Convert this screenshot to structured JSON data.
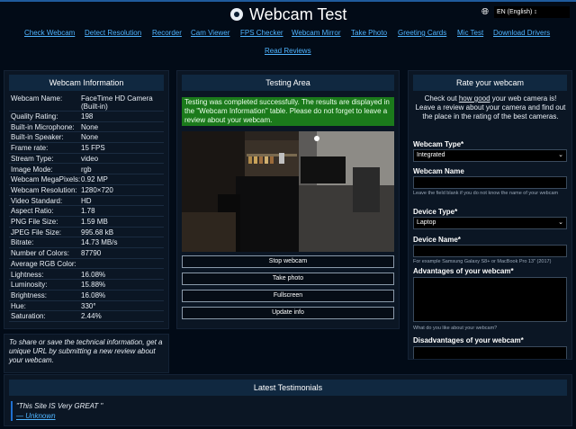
{
  "header": {
    "title": "Webcam Test",
    "language": "EN (English) ↕"
  },
  "nav": [
    "Check Webcam",
    "Detect Resolution",
    "Recorder",
    "Cam Viewer",
    "FPS Checker",
    "Webcam Mirror",
    "Take Photo",
    "Greeting Cards",
    "Mic Test",
    "Download Drivers",
    "Read Reviews"
  ],
  "info": {
    "title": "Webcam Information",
    "rows": [
      {
        "k": "Webcam Name:",
        "v": "FaceTime HD Camera (Built-in)"
      },
      {
        "k": "Quality Rating:",
        "v": "198"
      },
      {
        "k": "Built-in Microphone:",
        "v": "None"
      },
      {
        "k": "Built-in Speaker:",
        "v": "None"
      },
      {
        "k": "Frame rate:",
        "v": "15 FPS"
      },
      {
        "k": "Stream Type:",
        "v": "video"
      },
      {
        "k": "Image Mode:",
        "v": "rgb"
      },
      {
        "k": "Webcam MegaPixels:",
        "v": "0.92 MP"
      },
      {
        "k": "Webcam Resolution:",
        "v": "1280×720"
      },
      {
        "k": "Video Standard:",
        "v": "HD"
      },
      {
        "k": "Aspect Ratio:",
        "v": "1.78"
      },
      {
        "k": "PNG File Size:",
        "v": "1.59 MB"
      },
      {
        "k": "JPEG File Size:",
        "v": "995.68 kB"
      },
      {
        "k": "Bitrate:",
        "v": "14.73 MB/s"
      },
      {
        "k": "Number of Colors:",
        "v": "87790"
      },
      {
        "k": "Average RGB Color:",
        "v": ""
      },
      {
        "k": "Lightness:",
        "v": "16.08%"
      },
      {
        "k": "Luminosity:",
        "v": "15.88%"
      },
      {
        "k": "Brightness:",
        "v": "16.08%"
      },
      {
        "k": "Hue:",
        "v": "330°"
      },
      {
        "k": "Saturation:",
        "v": "2.44%"
      }
    ],
    "share_note": "To share or save the technical information, get a unique URL by submitting a new review about your webcam."
  },
  "testing": {
    "title": "Testing Area",
    "notice": "Testing was completed successfully. The results are displayed in the \"Webcam Information\" table. Please do not forget to leave a review about your webcam.",
    "buttons": [
      "Stop webcam",
      "Take photo",
      "Fullscreen",
      "Update info"
    ]
  },
  "rate": {
    "title": "Rate your webcam",
    "intro_before": "Check out ",
    "intro_link": "how good",
    "intro_after": " your web camera is! Leave a review about your camera and find out the place in the rating of the best cameras.",
    "webcam_type_label": "Webcam Type*",
    "webcam_type_value": "Integrated",
    "webcam_name_label": "Webcam Name",
    "webcam_name_hint": "Leave the field blank if you do not know the name of your webcam",
    "device_type_label": "Device Type*",
    "device_type_value": "Laptop",
    "device_name_label": "Device Name*",
    "device_name_hint": "For example Samsung Galaxy S8+ or MacBook Pro 13\" (2017)",
    "advantages_label": "Advantages of your webcam*",
    "advantages_hint": "What do you like about your webcam?",
    "disadvantages_label": "Disadvantages of your webcam*"
  },
  "testimonials": {
    "title": "Latest Testimonials",
    "quote": "\"This Site IS Very GREAT \"",
    "author": "— Unknown"
  },
  "colors": {
    "background": "#020b17",
    "panel_header": "#102840",
    "link": "#4fb4ff",
    "success": "#1b7a1b"
  }
}
